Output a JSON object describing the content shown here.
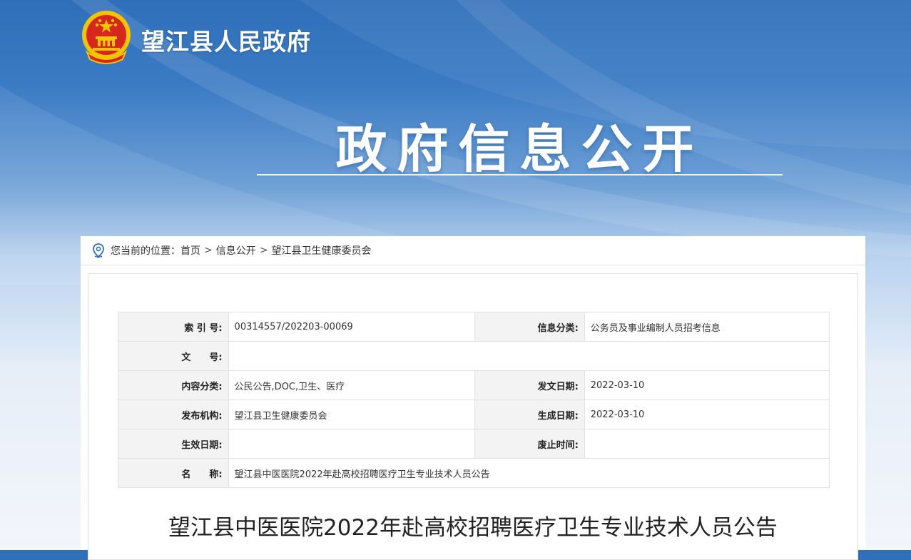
{
  "header": {
    "site_name": "望江县人民政府",
    "banner_title": "政府信息公开",
    "emblem": "national-emblem"
  },
  "breadcrumb": {
    "prefix": "您当前的位置：",
    "items": [
      "首页",
      "信息公开",
      "望江县卫生健康委员会"
    ],
    "separator": ">"
  },
  "meta_table": {
    "rows": [
      {
        "label1": "索 引 号:",
        "value1": "00314557/202203-00069",
        "label2": "信息分类:",
        "value2": "公务员及事业编制人员招考信息"
      },
      {
        "label1": "文　　号:",
        "value1": ""
      },
      {
        "label1": "内容分类:",
        "value1": "公民公告,DOC,卫生、医疗",
        "label2": "发文日期:",
        "value2": "2022-03-10"
      },
      {
        "label1": "发布机构:",
        "value1": "望江县卫生健康委员会",
        "label2": "生成日期:",
        "value2": "2022-03-10"
      },
      {
        "label1": "生效日期:",
        "value1": "",
        "label2": "废止时间:",
        "value2": ""
      },
      {
        "label1": "名　　称:",
        "value1": "望江县中医医院2022年赴高校招聘医疗卫生专业技术人员公告"
      }
    ]
  },
  "document": {
    "title": "望江县中医医院2022年赴高校招聘医疗卫生专业技术人员公告"
  },
  "colors": {
    "banner_blue": "#3b7bc4",
    "emblem_red": "#d7261e",
    "emblem_gold": "#f4c400"
  }
}
